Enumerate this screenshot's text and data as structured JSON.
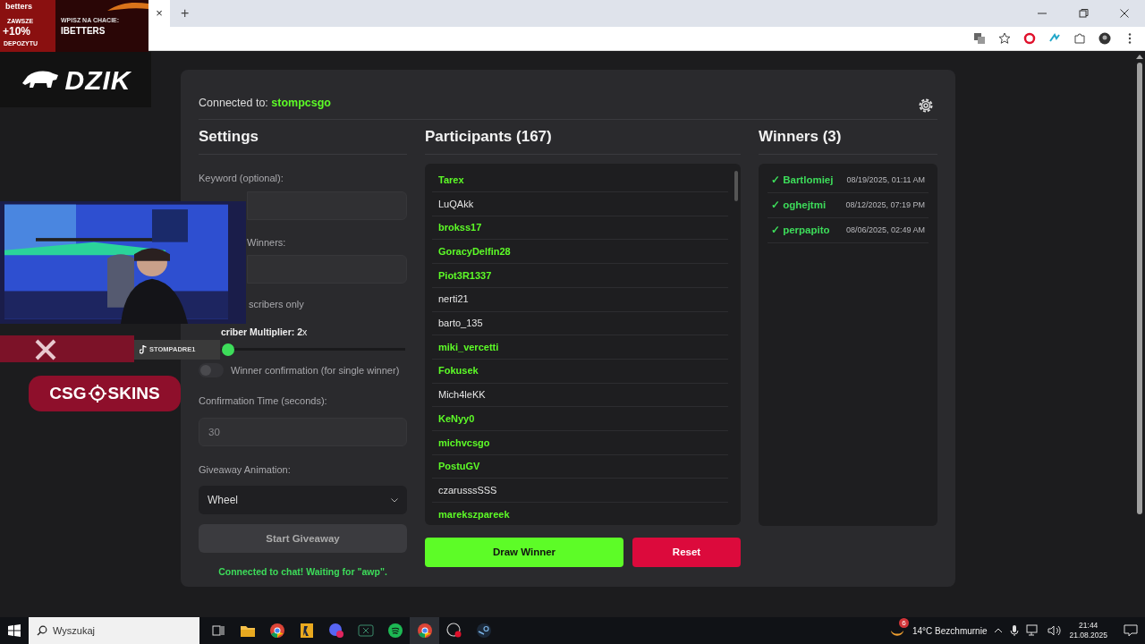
{
  "browser": {
    "tab_close": "×",
    "new_tab": "+"
  },
  "overlay": {
    "ad": {
      "brand": "betters",
      "tagline": "ZAWSZE",
      "bonus": "+10%",
      "bonus_note": "DEPOZYTU",
      "call": "WPISZ NA CHACIE:",
      "code": "IBETTERS"
    },
    "sponsor": "DZIK",
    "handle": "STOMPADRE1",
    "logo_left": "CSG",
    "logo_right": "SKINS"
  },
  "header": {
    "label": "Connected to:",
    "channel": "stompcsgo"
  },
  "settings": {
    "title": "Settings",
    "keyword_label": "Keyword (optional):",
    "winners_label": "Winners:",
    "subscribers_label": "scribers only",
    "multiplier": {
      "label": "**criber Multiplier: 2**x",
      "level": 0.04
    },
    "confirmation": {
      "label": "Winner confirmation (for single winner)",
      "on": false
    },
    "confirmation_time_label": "Confirmation Time (seconds):",
    "confirmation_time": {
      "value": "30",
      "disabled": true
    },
    "animation_label": "Giveaway Animation:",
    "animation": {
      "value": "Wheel"
    },
    "start_button": {
      "label": "Start Giveaway",
      "disabled": true
    },
    "status": "Connected to chat! Waiting for \"awp\"."
  },
  "participants": {
    "title": "Participants (167)",
    "items": [
      {
        "name": "Tarex",
        "highlighted": true
      },
      {
        "name": "LuQAkk",
        "highlighted": false
      },
      {
        "name": "brokss17",
        "highlighted": true
      },
      {
        "name": "GoracyDelfin28",
        "highlighted": true
      },
      {
        "name": "Piot3R1337",
        "highlighted": true
      },
      {
        "name": "nerti21",
        "highlighted": false
      },
      {
        "name": "barto_135",
        "highlighted": false
      },
      {
        "name": "miki_vercetti",
        "highlighted": true
      },
      {
        "name": "Fokusek",
        "highlighted": true
      },
      {
        "name": "Mich4leKK",
        "highlighted": false
      },
      {
        "name": "KeNyy0",
        "highlighted": true
      },
      {
        "name": "michvcsgo",
        "highlighted": true
      },
      {
        "name": "PostuGV",
        "highlighted": true
      },
      {
        "name": "czarusssSSS",
        "highlighted": false
      },
      {
        "name": "marekszpareek",
        "highlighted": true
      }
    ],
    "draw_button": "Draw Winner",
    "reset_button": "Reset"
  },
  "winners": {
    "title": "Winners (3)",
    "items": [
      {
        "check": "✓",
        "name": "Bartlomiej",
        "time": "08/19/2025, 01:11 AM"
      },
      {
        "check": "✓",
        "name": "oghejtmi",
        "time": "08/12/2025, 07:19 PM"
      },
      {
        "check": "✓",
        "name": "perpapito",
        "time": "08/06/2025, 02:49 AM"
      }
    ]
  },
  "taskbar": {
    "search_placeholder": "Wyszukaj",
    "weather": "14°C  Bezchmurnie",
    "weather_badge": "6",
    "time": "21:44",
    "date": "21.08.2025"
  }
}
